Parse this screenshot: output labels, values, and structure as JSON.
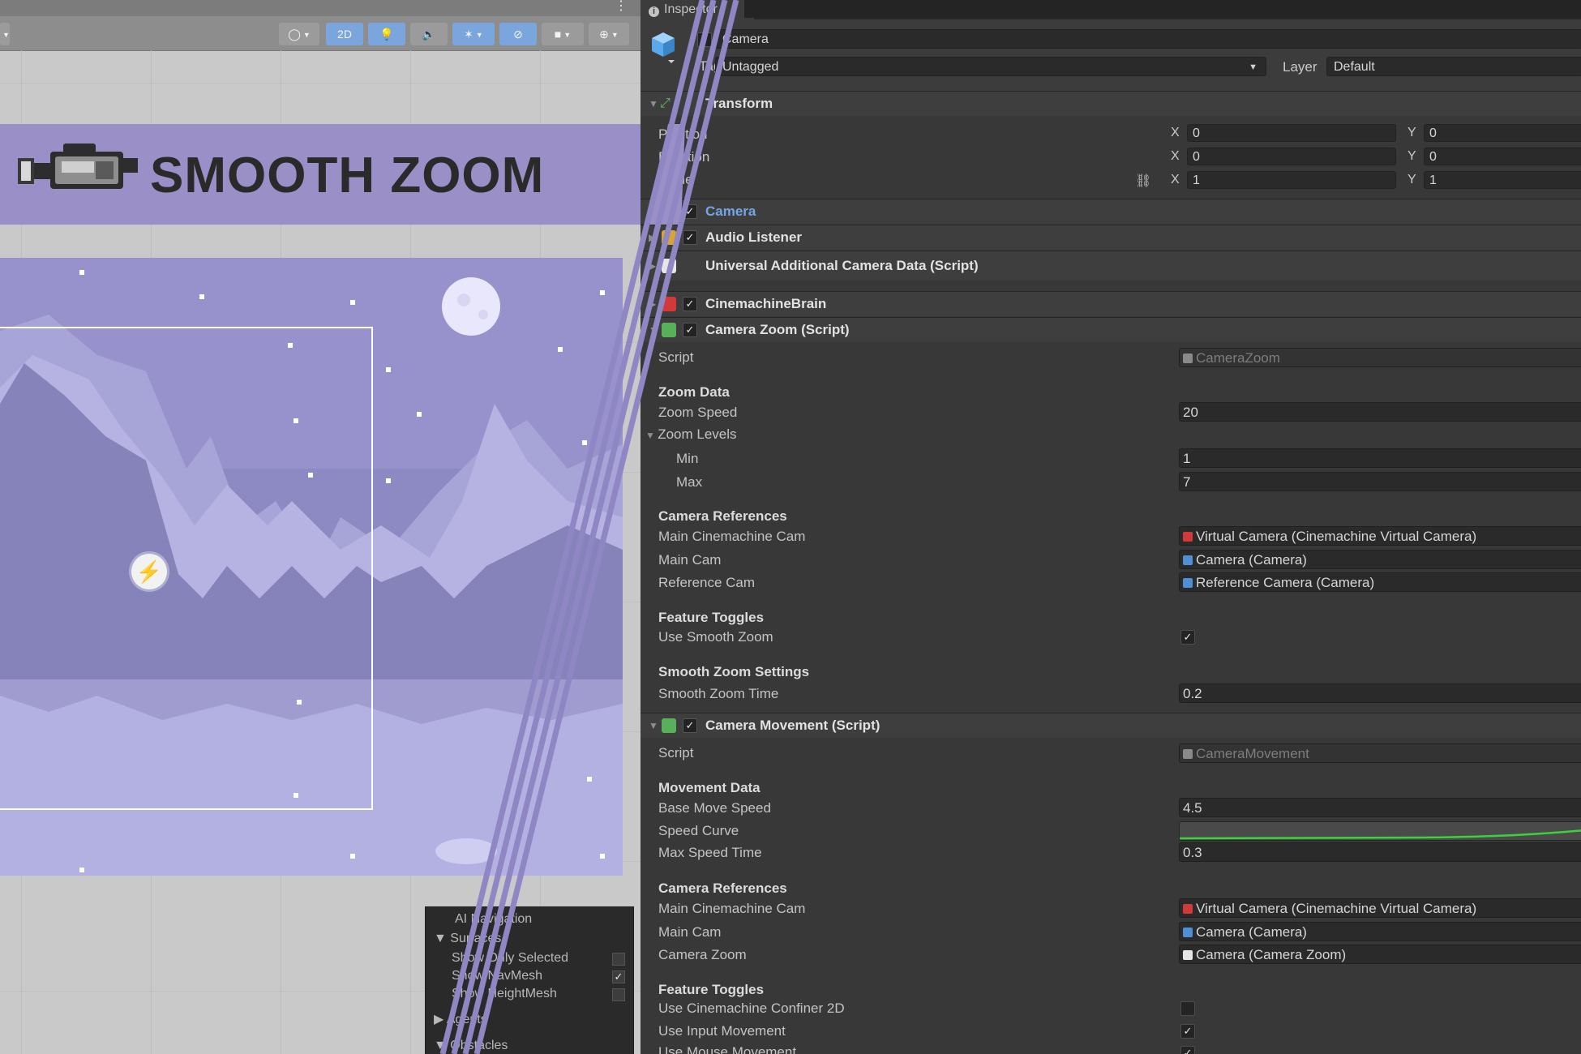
{
  "scene": {
    "toolbar": {
      "mode_2d": "2D",
      "icons": [
        "draw-mode-icon",
        "lighting-icon",
        "audio-icon",
        "effects-icon",
        "hidden-objects-icon",
        "camera-icon",
        "gizmos-icon"
      ]
    },
    "banner_title": "SMOOTH ZOOM",
    "ai_panel": {
      "title": "AI Navigation",
      "surfaces": "Surfaces",
      "rows": [
        "Show Only Selected",
        "Show NavMesh",
        "Show HeightMesh"
      ],
      "checked": [
        false,
        true,
        false
      ],
      "agents": "Agents",
      "obstacles": "Obstacles"
    }
  },
  "inspector": {
    "tab_label": "Inspector",
    "object_name": "Camera",
    "tag_label": "Tag",
    "tag_value": "Untagged",
    "layer_label": "Layer",
    "layer_value": "Default",
    "transform": {
      "title": "Transform",
      "rows": [
        {
          "label": "Position",
          "x": "0",
          "y": "0"
        },
        {
          "label": "Rotation",
          "x": "0",
          "y": "0"
        },
        {
          "label": "Scale",
          "x": "1",
          "y": "1"
        }
      ]
    },
    "components": {
      "camera": "Camera",
      "audio_listener": "Audio Listener",
      "urp_data": "Universal Additional Camera Data (Script)",
      "brain": "CinemachineBrain",
      "camera_zoom": "Camera Zoom (Script)",
      "camera_movement": "Camera Movement (Script)"
    },
    "camera_zoom": {
      "script_label": "Script",
      "script_value": "CameraZoom",
      "zoom_data": "Zoom Data",
      "zoom_speed_label": "Zoom Speed",
      "zoom_speed": "20",
      "zoom_levels": "Zoom Levels",
      "min_label": "Min",
      "min": "1",
      "max_label": "Max",
      "max": "7",
      "cam_refs": "Camera References",
      "main_cine_label": "Main Cinemachine Cam",
      "main_cine": "Virtual Camera (Cinemachine Virtual Camera)",
      "main_cam_label": "Main Cam",
      "main_cam": "Camera (Camera)",
      "ref_cam_label": "Reference Cam",
      "ref_cam": "Reference Camera (Camera)",
      "toggles": "Feature Toggles",
      "smooth_label": "Use Smooth Zoom",
      "smooth_checked": true,
      "smooth_settings": "Smooth Zoom Settings",
      "smooth_time_label": "Smooth Zoom Time",
      "smooth_time": "0.2"
    },
    "camera_movement": {
      "script_label": "Script",
      "script_value": "CameraMovement",
      "movement_data": "Movement Data",
      "base_speed_label": "Base Move Speed",
      "base_speed": "4.5",
      "curve_label": "Speed Curve",
      "max_time_label": "Max Speed Time",
      "max_time": "0.3",
      "cam_refs": "Camera References",
      "main_cine_label": "Main Cinemachine Cam",
      "main_cine": "Virtual Camera (Cinemachine Virtual Camera)",
      "main_cam_label": "Main Cam",
      "main_cam": "Camera (Camera)",
      "zoom_label": "Camera Zoom",
      "zoom": "Camera (Camera Zoom)",
      "toggles": "Feature Toggles",
      "confiner_label": "Use Cinemachine Confiner 2D",
      "confiner_checked": false,
      "input_label": "Use Input Movement",
      "input_checked": true,
      "mouse_label": "Use Mouse Movement",
      "mouse_checked": true
    }
  },
  "colors": {
    "banner": "#9a8fc7",
    "divider": "#8f86c4",
    "link_blue": "#73a5e8",
    "curve_green": "#3cd23c"
  }
}
